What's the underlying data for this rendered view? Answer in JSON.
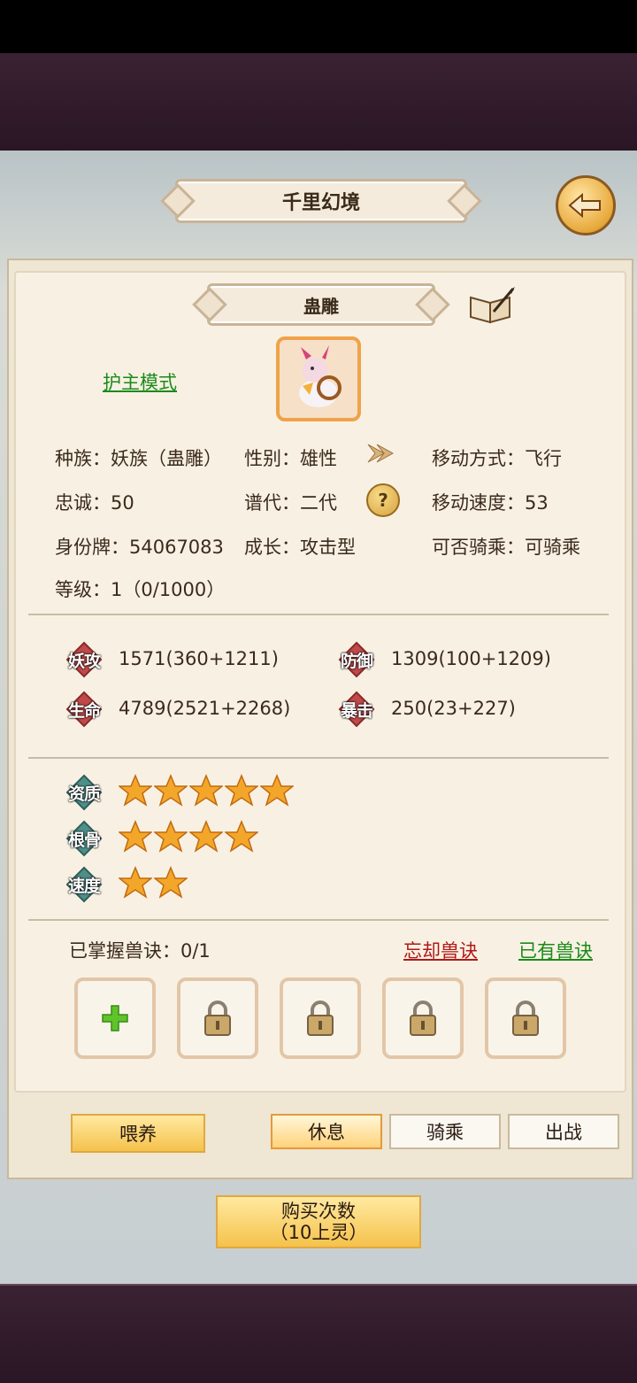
{
  "header": {
    "title": "千里幻境",
    "back_icon": "back-arrow-icon"
  },
  "pet": {
    "name": "蛊雕",
    "guard_mode": "护主模式",
    "info": {
      "race": "种族：妖族（蛊雕）",
      "gender": "性别：雄性",
      "move_type": "移动方式：飞行",
      "loyalty": "忠诚：50",
      "generation": "谱代：二代",
      "move_speed": "移动速度：53",
      "id_card": "身份牌：54067083",
      "growth": "成长：攻击型",
      "rideable": "可否骑乘：可骑乘",
      "level": "等级：1（0/1000）"
    },
    "stats": [
      {
        "label": "妖攻",
        "value": "1571(360+1211)",
        "color": "#c0494a"
      },
      {
        "label": "防御",
        "value": "1309(100+1209)",
        "color": "#c0494a"
      },
      {
        "label": "生命",
        "value": "4789(2521+2268)",
        "color": "#c0494a"
      },
      {
        "label": "暴击",
        "value": "250(23+227)",
        "color": "#c0494a"
      }
    ],
    "ratings": [
      {
        "label": "资质",
        "stars": 5
      },
      {
        "label": "根骨",
        "stars": 4
      },
      {
        "label": "速度",
        "stars": 2
      }
    ],
    "skills": {
      "mastered": "已掌握兽诀：0/1",
      "forget": "忘却兽诀",
      "owned": "已有兽诀",
      "slot_icons": [
        "plus-icon",
        "lock-icon",
        "lock-icon",
        "lock-icon",
        "lock-icon"
      ]
    }
  },
  "actions": {
    "feed": "喂养",
    "rest": "休息",
    "ride": "骑乘",
    "battle": "出战",
    "buy": "购买次数",
    "buy_cost": "（10上灵）"
  },
  "colors": {
    "gold": "#f5c24c",
    "green_link": "#1a8a1a",
    "red_link": "#b01818"
  }
}
